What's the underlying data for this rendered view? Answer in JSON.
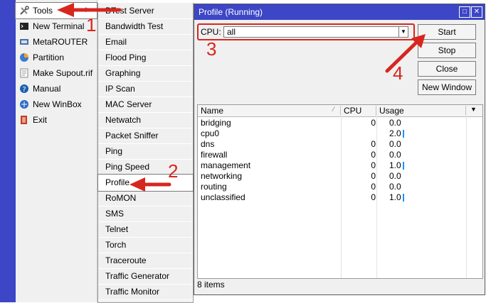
{
  "left_menu": {
    "items": [
      {
        "label": "Tools",
        "icon": "tools-icon"
      },
      {
        "label": "New Terminal",
        "icon": "terminal-icon"
      },
      {
        "label": "MetaROUTER",
        "icon": "metarouter-icon"
      },
      {
        "label": "Partition",
        "icon": "partition-icon"
      },
      {
        "label": "Make Supout.rif",
        "icon": "supout-icon"
      },
      {
        "label": "Manual",
        "icon": "manual-icon"
      },
      {
        "label": "New WinBox",
        "icon": "winbox-icon"
      },
      {
        "label": "Exit",
        "icon": "exit-icon"
      }
    ],
    "selected": "Tools"
  },
  "submenu": {
    "items": [
      "BTest Server",
      "Bandwidth Test",
      "Email",
      "Flood Ping",
      "Graphing",
      "IP Scan",
      "MAC Server",
      "Netwatch",
      "Packet Sniffer",
      "Ping",
      "Ping Speed",
      "Profile",
      "RoMON",
      "SMS",
      "Telnet",
      "Torch",
      "Traceroute",
      "Traffic Generator",
      "Traffic Monitor"
    ],
    "selected": "Profile"
  },
  "window": {
    "title": "Profile (Running)",
    "cpu_label": "CPU:",
    "cpu_value": "all",
    "buttons": {
      "start": "Start",
      "stop": "Stop",
      "close": "Close",
      "new_window": "New Window"
    },
    "table": {
      "columns": [
        "Name",
        "CPU",
        "Usage"
      ],
      "rows": [
        {
          "name": "bridging",
          "cpu": "0",
          "usage": "0.0"
        },
        {
          "name": "cpu0",
          "cpu": "",
          "usage": "2.0"
        },
        {
          "name": "dns",
          "cpu": "0",
          "usage": "0.0"
        },
        {
          "name": "firewall",
          "cpu": "0",
          "usage": "0.0"
        },
        {
          "name": "management",
          "cpu": "0",
          "usage": "1.0"
        },
        {
          "name": "networking",
          "cpu": "0",
          "usage": "0.0"
        },
        {
          "name": "routing",
          "cpu": "0",
          "usage": "0.0"
        },
        {
          "name": "unclassified",
          "cpu": "0",
          "usage": "1.0"
        }
      ]
    },
    "status": "8 items"
  },
  "annotations": {
    "n1": "1",
    "n2": "2",
    "n3": "3",
    "n4": "4"
  },
  "colors": {
    "accent": "#3c46c6",
    "arrow": "#d7261e",
    "usage_bar": "#1e90ff"
  }
}
